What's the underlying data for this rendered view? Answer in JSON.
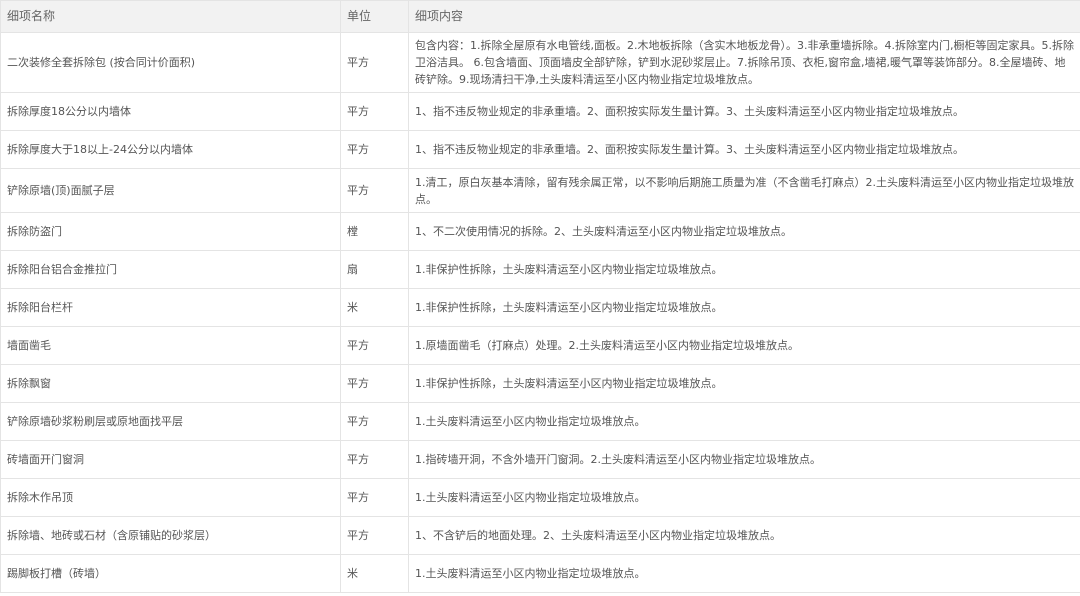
{
  "headers": [
    "细项名称",
    "单位",
    "细项内容"
  ],
  "rows": [
    {
      "name": "二次装修全套拆除包 (按合同计价面积)",
      "unit": "平方",
      "desc": "包含内容：1.拆除全屋原有水电管线,面板。2.木地板拆除（含实木地板龙骨）。3.非承重墙拆除。4.拆除室内门,橱柜等固定家具。5.拆除卫浴洁具。 6.包含墙面、顶面墙皮全部铲除，铲到水泥砂浆层止。7.拆除吊顶、衣柜,窗帘盒,墙裙,暖气罩等装饰部分。8.全屋墙砖、地砖铲除。9.现场清扫干净,土头废料清运至小区内物业指定垃圾堆放点。"
    },
    {
      "name": "拆除厚度18公分以内墙体",
      "unit": "平方",
      "desc": "1、指不违反物业规定的非承重墙。2、面积按实际发生量计算。3、土头废料清运至小区内物业指定垃圾堆放点。"
    },
    {
      "name": "拆除厚度大于18以上-24公分以内墙体",
      "unit": "平方",
      "desc": "1、指不违反物业规定的非承重墙。2、面积按实际发生量计算。3、土头废料清运至小区内物业指定垃圾堆放点。"
    },
    {
      "name": "铲除原墙(顶)面腻子层",
      "unit": "平方",
      "desc": "1.清工，原白灰基本清除，留有残余属正常，以不影响后期施工质量为准（不含凿毛打麻点）2.土头废料清运至小区内物业指定垃圾堆放点。"
    },
    {
      "name": "拆除防盗门",
      "unit": "樘",
      "desc": "1、不二次使用情况的拆除。2、土头废料清运至小区内物业指定垃圾堆放点。"
    },
    {
      "name": "拆除阳台铝合金推拉门",
      "unit": "扇",
      "desc": "1.非保护性拆除，土头废料清运至小区内物业指定垃圾堆放点。"
    },
    {
      "name": "拆除阳台栏杆",
      "unit": "米",
      "desc": "1.非保护性拆除，土头废料清运至小区内物业指定垃圾堆放点。"
    },
    {
      "name": "墙面凿毛",
      "unit": "平方",
      "desc": "1.原墙面凿毛（打麻点）处理。2.土头废料清运至小区内物业指定垃圾堆放点。"
    },
    {
      "name": "拆除飘窗",
      "unit": "平方",
      "desc": "1.非保护性拆除，土头废料清运至小区内物业指定垃圾堆放点。"
    },
    {
      "name": "铲除原墙砂浆粉刷层或原地面找平层",
      "unit": "平方",
      "desc": "1.土头废料清运至小区内物业指定垃圾堆放点。"
    },
    {
      "name": "砖墙面开门窗洞",
      "unit": "平方",
      "desc": "1.指砖墙开洞，不含外墙开门窗洞。2.土头废料清运至小区内物业指定垃圾堆放点。"
    },
    {
      "name": "拆除木作吊顶",
      "unit": "平方",
      "desc": "1.土头废料清运至小区内物业指定垃圾堆放点。"
    },
    {
      "name": "拆除墙、地砖或石材（含原铺贴的砂浆层）",
      "unit": "平方",
      "desc": "1、不含铲后的地面处理。2、土头废料清运至小区内物业指定垃圾堆放点。"
    },
    {
      "name": "踢脚板打槽（砖墙）",
      "unit": "米",
      "desc": "1.土头废料清运至小区内物业指定垃圾堆放点。"
    }
  ]
}
